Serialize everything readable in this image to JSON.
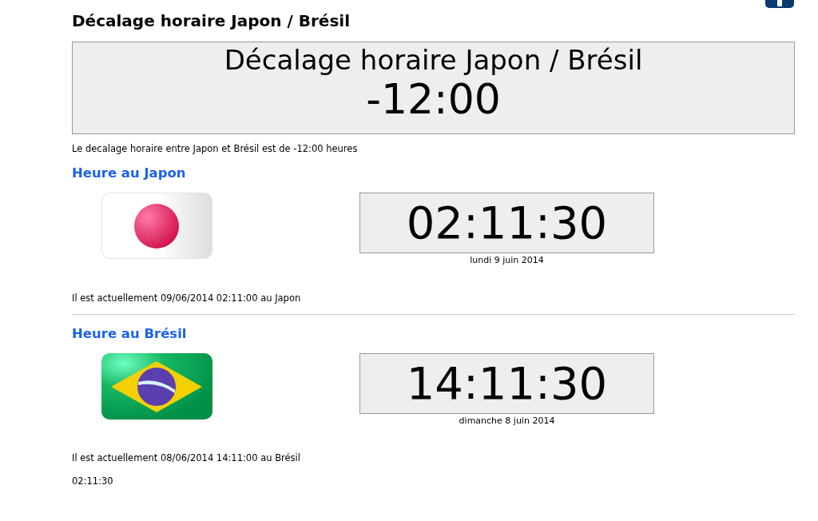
{
  "page_title": "Décalage horaire Japon / Brésil",
  "banner": {
    "title": "Décalage horaire Japon / Brésil",
    "offset": "-12:00"
  },
  "summary": "Le decalage horaire entre Japon et Brésil est de -12:00 heures",
  "zones": [
    {
      "heading": "Heure au Japon",
      "kind": "japan",
      "clock": "02:11:30",
      "date": "lundi 9 juin 2014",
      "current": "Il est actuellement 09/06/2014 02:11:00 au Japon"
    },
    {
      "heading": "Heure au Brésil",
      "kind": "brazil",
      "clock": "14:11:30",
      "date": "dimanche 8 juin 2014",
      "current": "Il est actuellement 08/06/2014 14:11:00 au Brésil"
    }
  ],
  "footer_time": "02:11:30"
}
